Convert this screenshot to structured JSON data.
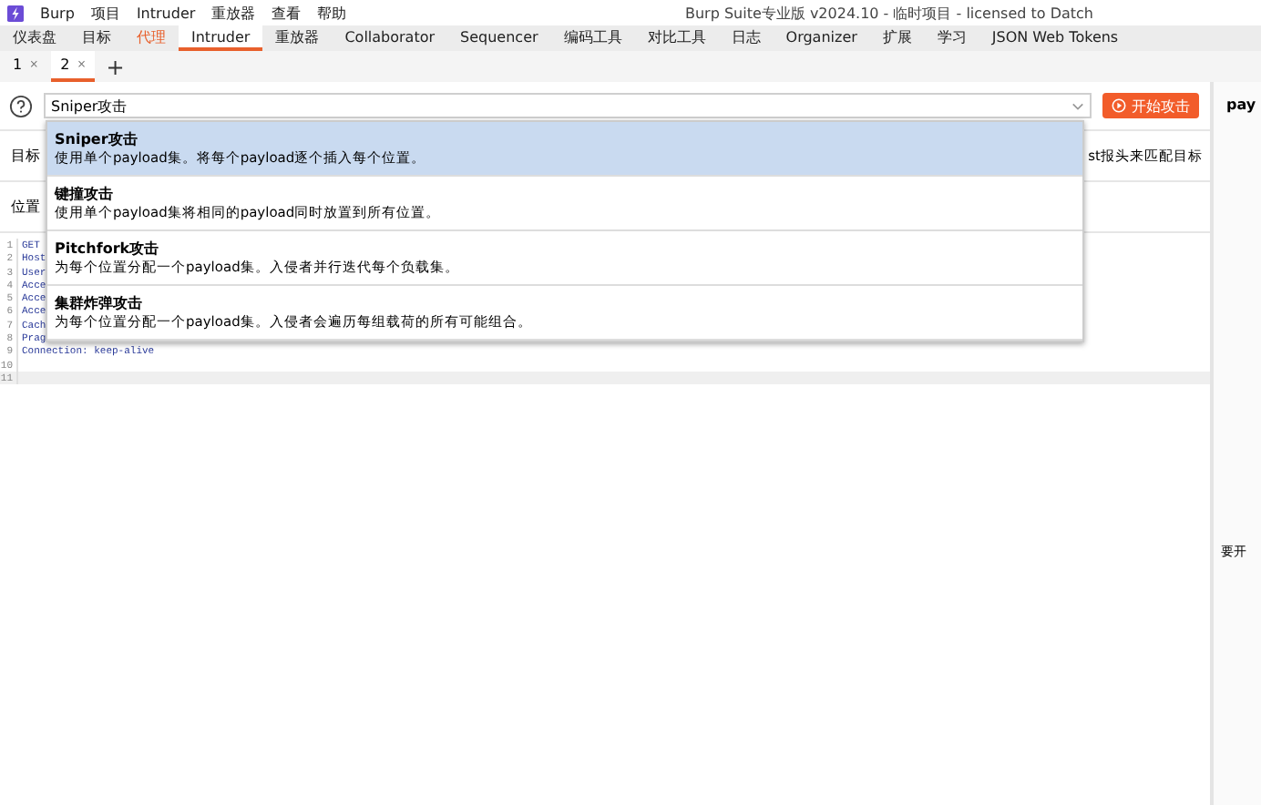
{
  "menu": {
    "items": [
      "Burp",
      "项目",
      "Intruder",
      "重放器",
      "查看",
      "帮助"
    ],
    "title": "Burp Suite专业版  v2024.10 - 临时项目 - licensed to Datch"
  },
  "tabs": [
    {
      "label": "仪表盘",
      "selected": false,
      "notified": false
    },
    {
      "label": "目标",
      "selected": false,
      "notified": false
    },
    {
      "label": "代理",
      "selected": false,
      "notified": true
    },
    {
      "label": "Intruder",
      "selected": true,
      "notified": false
    },
    {
      "label": "重放器",
      "selected": false,
      "notified": false
    },
    {
      "label": "Collaborator",
      "selected": false,
      "notified": false
    },
    {
      "label": "Sequencer",
      "selected": false,
      "notified": false
    },
    {
      "label": "编码工具",
      "selected": false,
      "notified": false
    },
    {
      "label": "对比工具",
      "selected": false,
      "notified": false
    },
    {
      "label": "日志",
      "selected": false,
      "notified": false
    },
    {
      "label": "Organizer",
      "selected": false,
      "notified": false
    },
    {
      "label": "扩展",
      "selected": false,
      "notified": false
    },
    {
      "label": "学习",
      "selected": false,
      "notified": false
    },
    {
      "label": "JSON Web Tokens",
      "selected": false,
      "notified": false
    }
  ],
  "subtabs": [
    {
      "label": "1",
      "close": "×",
      "selected": false
    },
    {
      "label": "2",
      "close": "×",
      "selected": true
    }
  ],
  "add_tab": "+",
  "attack_type": {
    "value": "Sniper攻击",
    "options": [
      {
        "title": "Sniper攻击",
        "description": "使用单个payload集。将每个payload逐个插入每个位置。",
        "selected": true
      },
      {
        "title": "键撞攻击",
        "description": "使用单个payload集将相同的payload同时放置到所有位置。",
        "selected": false
      },
      {
        "title": "Pitchfork攻击",
        "description": "为每个位置分配一个payload集。入侵者并行迭代每个负载集。",
        "selected": false
      },
      {
        "title": "集群炸弹攻击",
        "description": "为每个位置分配一个payload集。入侵者会遍历每组载荷的所有可能组合。",
        "selected": false
      }
    ]
  },
  "start_button": "开始攻击",
  "rows": [
    {
      "label": "目标",
      "text": "st报头来匹配目标"
    },
    {
      "label": "位置"
    }
  ],
  "editor": {
    "lines": [
      {
        "number": "1",
        "text": "GET",
        "current": false
      },
      {
        "number": "2",
        "text": "Host",
        "current": false
      },
      {
        "number": "3",
        "text": "User",
        "current": false
      },
      {
        "number": "4",
        "text": "Acce",
        "current": false
      },
      {
        "number": "5",
        "text": "Acce",
        "current": false
      },
      {
        "number": "6",
        "text": "Acce",
        "current": false
      },
      {
        "number": "7",
        "text": "Cach",
        "current": false
      },
      {
        "number": "8",
        "text": "Prag",
        "current": false
      },
      {
        "number": "9",
        "text": "Connection: keep-alive",
        "current": false
      },
      {
        "number": "10",
        "current": false
      },
      {
        "number": "11",
        "current": true
      }
    ]
  },
  "side_panel": {
    "heading": "pay",
    "note": "要开"
  }
}
